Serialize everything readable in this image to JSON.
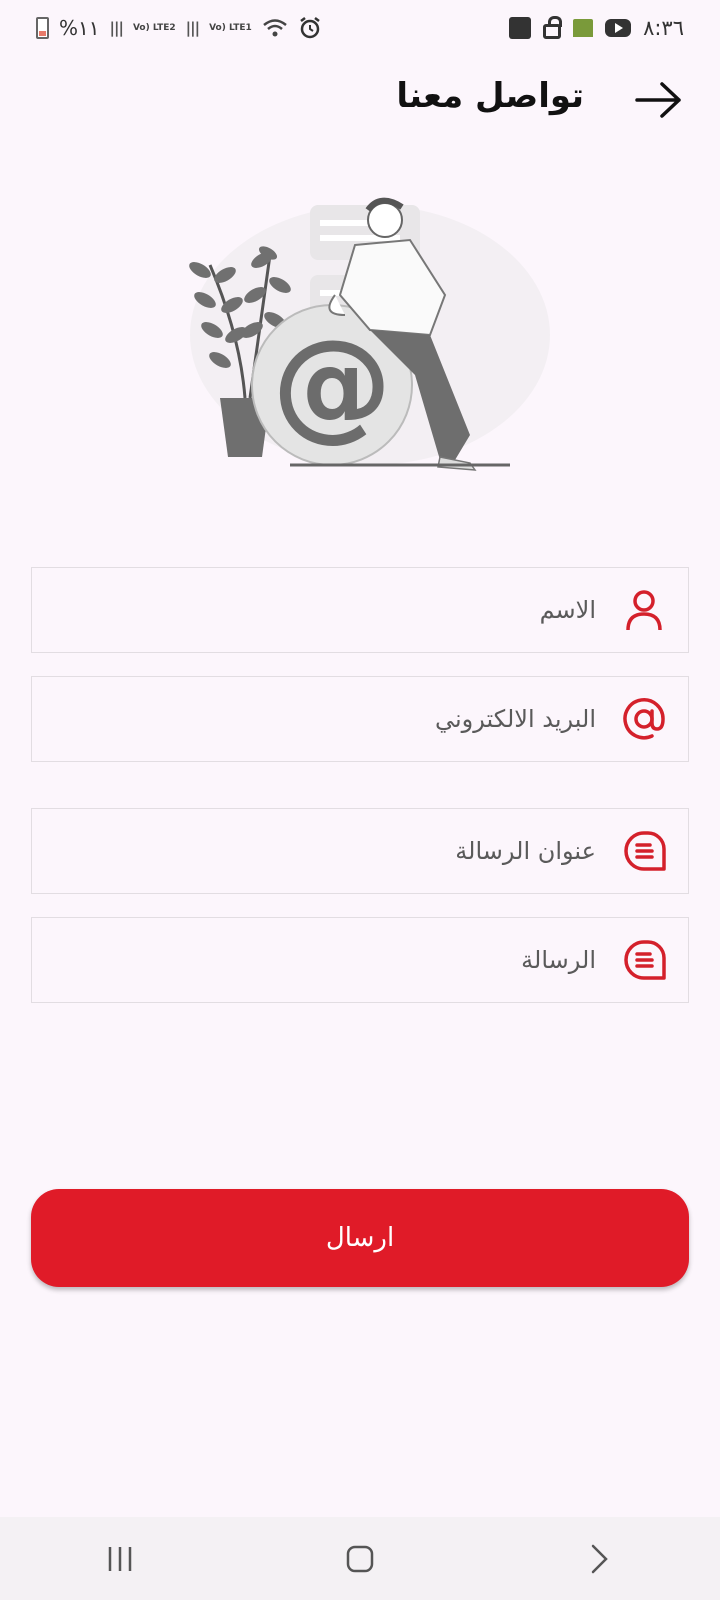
{
  "status_bar": {
    "battery_text": "%١١",
    "net1": "Vo) LTE2",
    "net2": "Vo) LTE1",
    "time": "٨:٣٦"
  },
  "header": {
    "title": "تواصل معنا",
    "back_icon": "arrow-right-icon"
  },
  "form": {
    "fields": [
      {
        "placeholder": "الاسم",
        "icon": "person-icon"
      },
      {
        "placeholder": "البريد الالكتروني",
        "icon": "at-icon"
      },
      {
        "placeholder": "عنوان الرسالة",
        "icon": "message-icon"
      },
      {
        "placeholder": "الرسالة",
        "icon": "message-icon"
      }
    ],
    "submit_label": "ارسال"
  },
  "colors": {
    "accent": "#e01b28",
    "background": "#fcf6fc"
  },
  "nav": {
    "items": [
      "recent-apps-icon",
      "home-icon",
      "back-icon"
    ]
  }
}
